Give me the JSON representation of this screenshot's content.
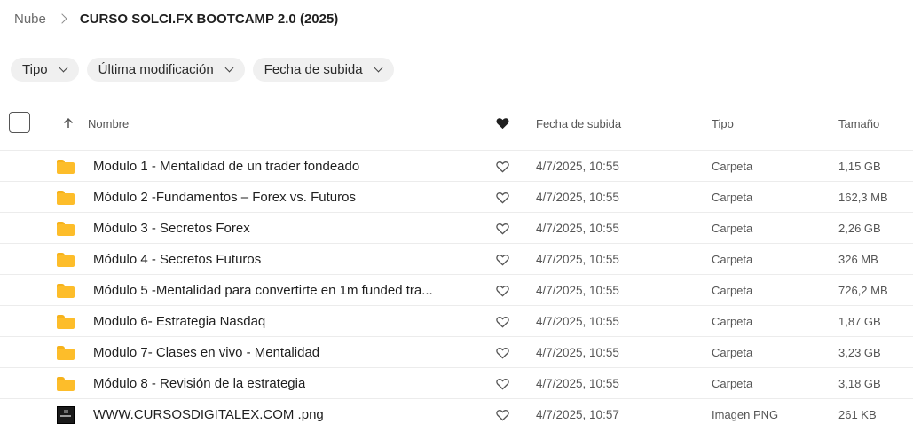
{
  "breadcrumb": {
    "root": "Nube",
    "current": "CURSO SOLCI.FX BOOTCAMP 2.0 (2025)"
  },
  "filters": [
    {
      "label": "Tipo"
    },
    {
      "label": "Última modificación"
    },
    {
      "label": "Fecha de subida"
    }
  ],
  "columns": {
    "name": "Nombre",
    "date": "Fecha de subida",
    "type": "Tipo",
    "size": "Tamaño"
  },
  "files": [
    {
      "name": "Modulo 1 - Mentalidad de un trader fondeado",
      "date": "4/7/2025, 10:55",
      "type": "Carpeta",
      "size": "1,15 GB",
      "icon": "folder-icon"
    },
    {
      "name": "Módulo 2 -Fundamentos – Forex vs. Futuros",
      "date": "4/7/2025, 10:55",
      "type": "Carpeta",
      "size": "162,3 MB",
      "icon": "folder-icon"
    },
    {
      "name": "Módulo 3 - Secretos Forex",
      "date": "4/7/2025, 10:55",
      "type": "Carpeta",
      "size": "2,26 GB",
      "icon": "folder-icon"
    },
    {
      "name": "Módulo 4 - Secretos Futuros",
      "date": "4/7/2025, 10:55",
      "type": "Carpeta",
      "size": "326 MB",
      "icon": "folder-icon"
    },
    {
      "name": "Módulo 5 -Mentalidad para convertirte en 1m funded tra...",
      "date": "4/7/2025, 10:55",
      "type": "Carpeta",
      "size": "726,2 MB",
      "icon": "folder-icon"
    },
    {
      "name": "Modulo 6- Estrategia Nasdaq",
      "date": "4/7/2025, 10:55",
      "type": "Carpeta",
      "size": "1,87 GB",
      "icon": "folder-icon"
    },
    {
      "name": "Modulo 7- Clases en vivo - Mentalidad",
      "date": "4/7/2025, 10:55",
      "type": "Carpeta",
      "size": "3,23 GB",
      "icon": "folder-icon"
    },
    {
      "name": "Módulo 8 - Revisión de la estrategia",
      "date": "4/7/2025, 10:55",
      "type": "Carpeta",
      "size": "3,18 GB",
      "icon": "folder-icon"
    },
    {
      "name": "WWW.CURSOSDIGITALEX.COM .png",
      "date": "4/7/2025, 10:57",
      "type": "Imagen PNG",
      "size": "261 KB",
      "icon": "image-thumbnail-icon"
    }
  ],
  "colors": {
    "folder": "#fdbd2a",
    "chip_bg": "#f0f0f0",
    "row_divider": "#ececec"
  }
}
